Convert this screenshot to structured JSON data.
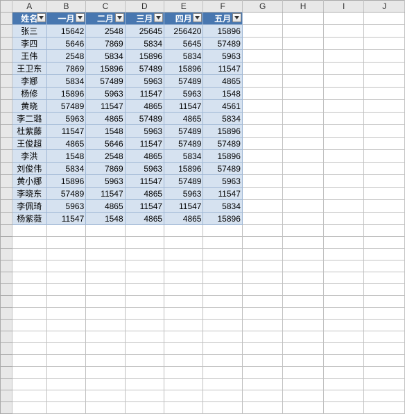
{
  "columns": [
    "A",
    "B",
    "C",
    "D",
    "E",
    "F",
    "G",
    "H",
    "I",
    "J"
  ],
  "header": {
    "name": "姓名",
    "months": [
      "一月",
      "二月",
      "三月",
      "四月",
      "五月"
    ]
  },
  "rows": [
    {
      "name": "张三",
      "v": [
        15642,
        2548,
        25645,
        256420,
        15896
      ]
    },
    {
      "name": "李四",
      "v": [
        5646,
        7869,
        5834,
        5645,
        57489
      ]
    },
    {
      "name": "王伟",
      "v": [
        2548,
        5834,
        15896,
        5834,
        5963
      ]
    },
    {
      "name": "王卫东",
      "v": [
        7869,
        15896,
        57489,
        15896,
        11547
      ]
    },
    {
      "name": "李娜",
      "v": [
        5834,
        57489,
        5963,
        57489,
        4865
      ]
    },
    {
      "name": "杨修",
      "v": [
        15896,
        5963,
        11547,
        5963,
        1548
      ]
    },
    {
      "name": "黄晓",
      "v": [
        57489,
        11547,
        4865,
        11547,
        4561
      ]
    },
    {
      "name": "李二璐",
      "v": [
        5963,
        4865,
        57489,
        4865,
        5834
      ]
    },
    {
      "name": "杜紫藤",
      "v": [
        11547,
        1548,
        5963,
        57489,
        15896
      ]
    },
    {
      "name": "王俊超",
      "v": [
        4865,
        5646,
        11547,
        57489,
        57489
      ]
    },
    {
      "name": "李洪",
      "v": [
        1548,
        2548,
        4865,
        5834,
        15896
      ]
    },
    {
      "name": "刘俊伟",
      "v": [
        5834,
        7869,
        5963,
        15896,
        57489
      ]
    },
    {
      "name": "黄小娜",
      "v": [
        15896,
        5963,
        11547,
        57489,
        5963
      ]
    },
    {
      "name": "李晓东",
      "v": [
        57489,
        11547,
        4865,
        5963,
        11547
      ]
    },
    {
      "name": "李佩琦",
      "v": [
        5963,
        4865,
        11547,
        11547,
        5834
      ]
    },
    {
      "name": "杨紫薇",
      "v": [
        11547,
        1548,
        4865,
        4865,
        15896
      ]
    }
  ],
  "empty_rows": 16
}
